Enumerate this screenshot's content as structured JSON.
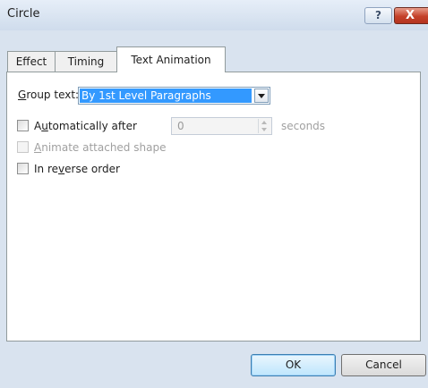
{
  "window": {
    "title": "Circle",
    "help_label": "?",
    "close_label": "X"
  },
  "tabs": [
    {
      "label": "Effect",
      "active": false
    },
    {
      "label": "Timing",
      "active": false
    },
    {
      "label": "Text Animation",
      "active": true
    }
  ],
  "text_animation": {
    "group_text": {
      "label_prefix": "",
      "label_accel": "G",
      "label_rest": "roup text:",
      "value": "By 1st Level Paragraphs"
    },
    "auto_after": {
      "checked": false,
      "label_prefix": "A",
      "label_accel": "u",
      "label_rest": "tomatically after",
      "value": "0",
      "unit": "seconds"
    },
    "animate_shape": {
      "checked": false,
      "enabled": false,
      "label_prefix": "",
      "label_accel": "A",
      "label_rest": "nimate attached shape"
    },
    "reverse_order": {
      "checked": false,
      "label_prefix": "In re",
      "label_accel": "v",
      "label_rest": "erse order"
    }
  },
  "buttons": {
    "ok": "OK",
    "cancel": "Cancel"
  },
  "colors": {
    "selection": "#3399ff",
    "close": "#c4412a",
    "frame": "#d9e3ef"
  }
}
